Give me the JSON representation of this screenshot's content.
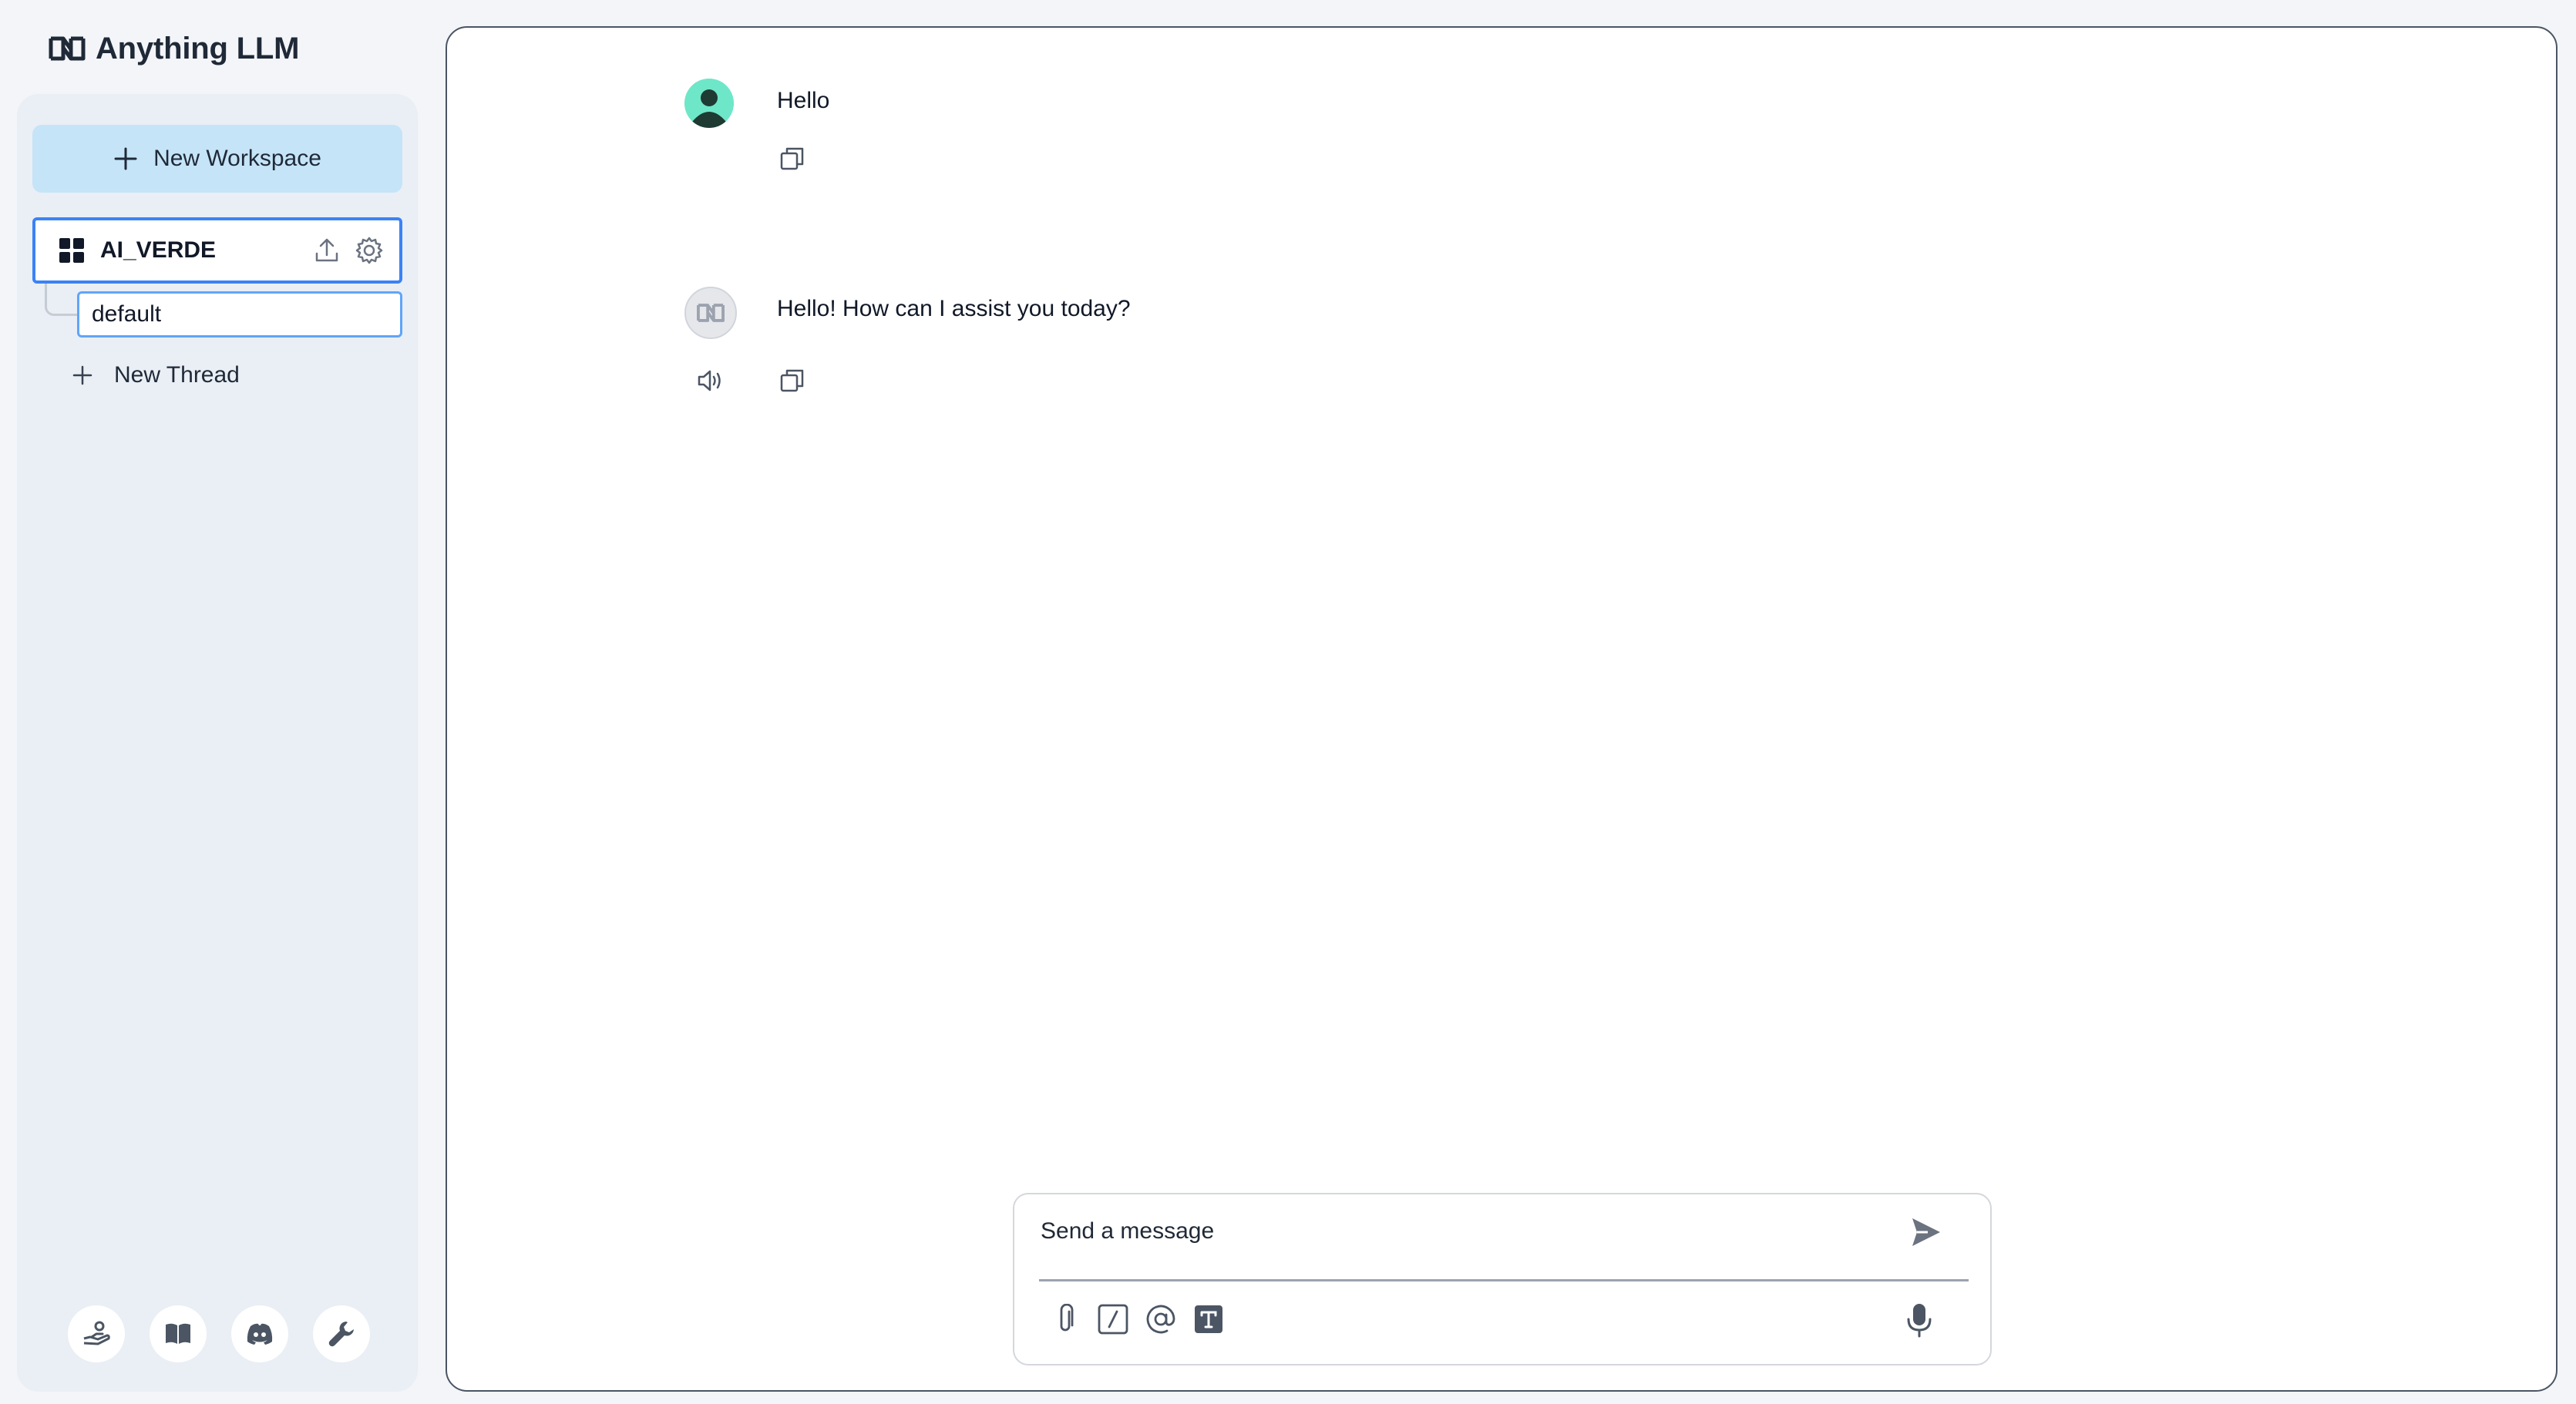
{
  "app": {
    "brand": "Anything LLM"
  },
  "sidebar": {
    "new_workspace_label": "New Workspace",
    "workspace": {
      "name": "AI_VERDE"
    },
    "thread": {
      "name": "default"
    },
    "new_thread_label": "New Thread",
    "footer_icons": [
      "community-hub-icon",
      "docs-book-icon",
      "discord-icon",
      "settings-wrench-icon"
    ]
  },
  "chat": {
    "messages": [
      {
        "role": "user",
        "text": "Hello"
      },
      {
        "role": "assistant",
        "text": "Hello! How can I assist you today?"
      }
    ]
  },
  "composer": {
    "placeholder": "Send a message",
    "tools": [
      "attach-icon",
      "slash-command-icon",
      "at-mention-icon",
      "text-size-icon"
    ]
  },
  "colors": {
    "accent": "#3b82f6",
    "new_workspace_bg": "#c6e4f8",
    "sidebar_bg": "#eaeff5",
    "user_avatar": "#6ee7c8"
  }
}
